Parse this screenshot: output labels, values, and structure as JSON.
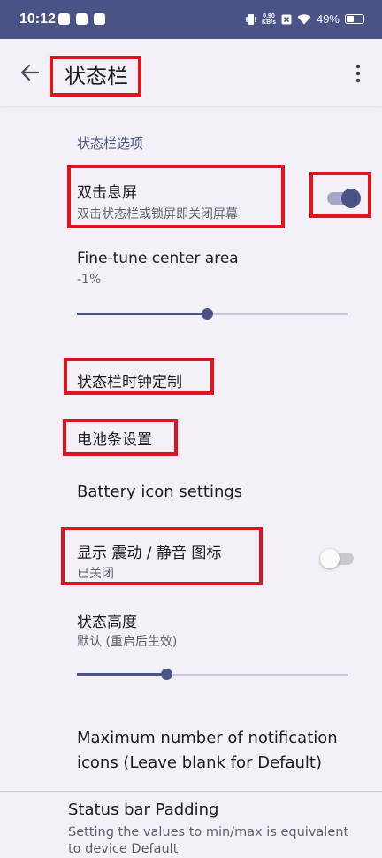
{
  "status_bar": {
    "time": "10:12",
    "net_speed_value": "0.90",
    "net_speed_unit": "KB/s",
    "battery": "49%",
    "battery_level": 0.49,
    "icons": [
      "mail-icon",
      "app-icon",
      "tiktok-icon",
      "vibrate-icon",
      "close-box-icon",
      "wifi-icon",
      "battery-icon"
    ]
  },
  "header": {
    "title": "状态栏",
    "back_icon": "back-arrow-icon",
    "more_icon": "more-vert-icon"
  },
  "settings": {
    "category": "状态栏选项",
    "double_tap": {
      "title": "双击息屏",
      "summary": "双击状态栏或锁屏即关闭屏幕",
      "enabled": true
    },
    "center_area": {
      "title": "Fine-tune center area",
      "value": "-1%",
      "slider_fraction": 0.48
    },
    "clock": {
      "title": "状态栏时钟定制"
    },
    "battery_bar": {
      "title": "电池条设置"
    },
    "battery_icon": {
      "title": "Battery icon settings"
    },
    "vibrate_mute": {
      "title": "显示 震动 / 静音 图标",
      "summary": "已关闭",
      "enabled": false
    },
    "height": {
      "title": "状态高度",
      "summary": "默认 (重启后生效)",
      "slider_fraction": 0.33
    },
    "max_notif": {
      "title_line1": "Maximum number of notification",
      "title_line2": "icons (Leave blank for Default)"
    },
    "padding": {
      "title": "Status bar Padding",
      "summary": "Setting the values to min/max is equivalent to device Default"
    }
  },
  "colors": {
    "accent": "#4a5386",
    "highlight": "#e0141e",
    "background": "#f3f1f7",
    "switch_on_track": "#a3a7c7",
    "switch_off_track": "#c9c8cf"
  }
}
